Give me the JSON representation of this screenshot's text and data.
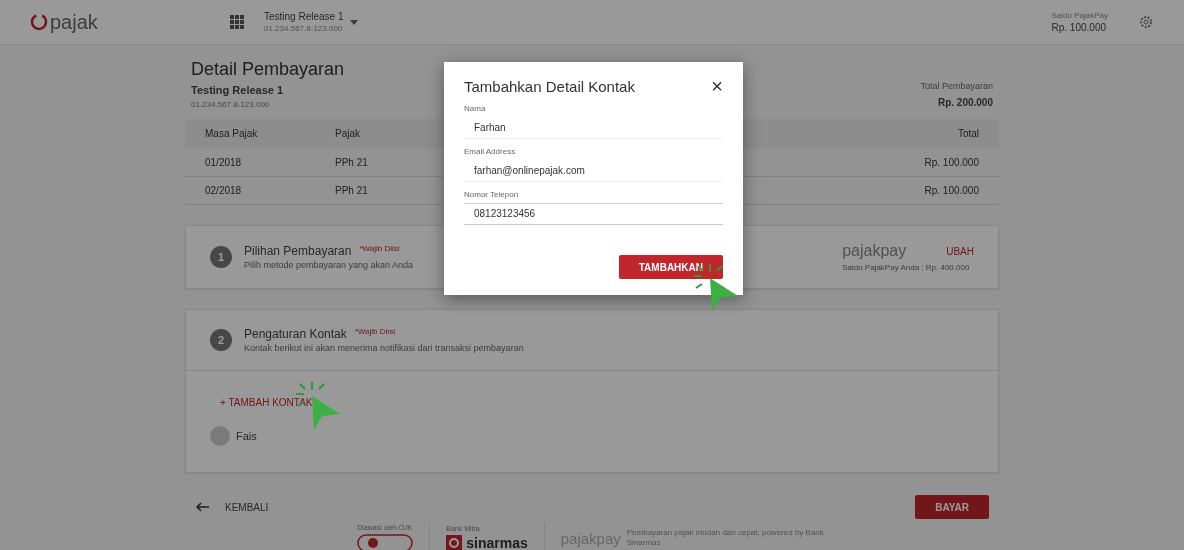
{
  "header": {
    "logo": "pajak",
    "company": "Testing Release 1",
    "npwp": "01.234.567.8-123.000",
    "balance_label": "Saldo PajakPay",
    "balance": "Rp. 100.000"
  },
  "page": {
    "title": "Detail Pembayaran",
    "company": "Testing Release 1",
    "npwp": "01.234.567.8-123.000",
    "total_label": "Total Pembayaran",
    "total": "Rp. 200.000"
  },
  "table": {
    "columns": [
      "Masa Pajak",
      "Pajak",
      "Total"
    ],
    "rows": [
      {
        "cells": [
          "01/2018",
          "PPh 21",
          "Rp. 100.000"
        ]
      },
      {
        "cells": [
          "02/2018",
          "PPh 21",
          "Rp. 100.000"
        ]
      }
    ]
  },
  "steps": [
    {
      "number": "1",
      "title": "Pilihan Pembayaran",
      "required": "*Wajib Diisi",
      "description": "Pilih metode pembayaran yang akan Anda",
      "method_logo": "pajakpay",
      "change": "UBAH",
      "method_balance": "Saldo PajakPay Anda : Rp. 400.000"
    },
    {
      "number": "2",
      "title": "Pengaturan Kontak",
      "required": "*Wajib Diisi",
      "description": "Kontak berikut ini akan menerima notifikasi dari transaksi pembayaran",
      "add_contact": "+ TAMBAH KONTAK",
      "contacts": [
        {
          "name": "Fais",
          "selected": false
        }
      ]
    }
  ],
  "footer": {
    "back": "KEMBALI",
    "pay": "BAYAR",
    "supervised_label": "Diawasi oleh OJK",
    "partner_label": "Bank Mitra",
    "partner": "sinarmas",
    "pajakpay": "pajakpay",
    "pajakpay_tagline": "Pembayaran pajak mudah dan cepat, powered by Bank Sinarmas"
  },
  "dialog": {
    "title": "Tambahkan Detail Kontak",
    "close": "×",
    "fields": [
      {
        "label": "Nama",
        "value": "Farhan",
        "focused": false
      },
      {
        "label": "Email Address",
        "value": "farhan@onlinepajak.com",
        "focused": false
      },
      {
        "label": "Nomor Telepon",
        "value": "08123123456",
        "focused": true
      }
    ],
    "submit": "TAMBAHKAN"
  }
}
